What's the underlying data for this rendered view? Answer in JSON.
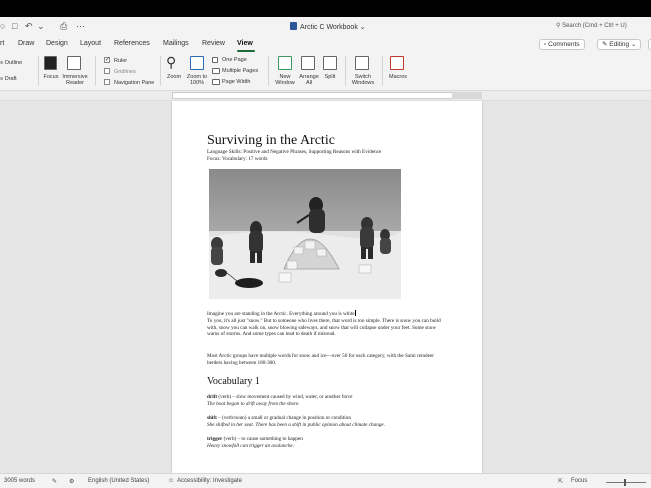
{
  "window": {
    "title": "Arctic C Workbook",
    "search_placeholder": "Search (Cmd + Ctrl + U)"
  },
  "titlebar_icons": [
    "sidebar-icon",
    "save-icon",
    "undo-icon",
    "redo-icon",
    "print-icon",
    "more-icon"
  ],
  "tabs": [
    "rt",
    "Draw",
    "Design",
    "Layout",
    "References",
    "Mailings",
    "Review",
    "View"
  ],
  "active_tab": "View",
  "top_right": {
    "comments": "Comments",
    "editing": "Editing"
  },
  "ribbon": {
    "views": {
      "outline": "Outline",
      "draft": "Draft"
    },
    "focus": "Focus",
    "immersive_reader": "Immersive Reader",
    "ruler": {
      "label": "Ruler",
      "checked": true
    },
    "gridlines": {
      "label": "Gridlines",
      "checked": false
    },
    "navigation_pane": {
      "label": "Navigation Pane",
      "checked": false
    },
    "zoom": "Zoom",
    "zoom_100": "Zoom to 100%",
    "one_page": "One Page",
    "multiple_pages": "Multiple Pages",
    "page_width": "Page Width",
    "new_window": "New Window",
    "arrange_all": "Arrange All",
    "split": "Split",
    "switch_windows": "Switch Windows",
    "macros": "Macros"
  },
  "document": {
    "title": "Surviving in the Arctic",
    "subtitle1": "Language Skills: Positive and Negative Phrases, Supporting Reasons with Evidence",
    "subtitle2": "Focus: Vocabulary: 17 words",
    "para1_before_cursor": "Imagine you are standing in the Arctic. Everything around you is white",
    "para1_rest": "To you, it's all just \"snow.\" But to someone who lives there, that word is too simple. There is snow you can build with, snow you can walk on, snow blowing sideways, and snow that will collapse under your feet. Some snow warns of storms. And some types can lead to death if misread.",
    "para2": "Most Arctic groups have multiple words for snow and ice—over 50 for each category, with the Sami reindeer herders having between 180-300.",
    "vocab_heading": "Vocabulary 1",
    "terms": [
      {
        "word": "drift",
        "def": " (verb) – slow movement caused by wind, water, or another force",
        "example": "The boat began to drift away from the shore."
      },
      {
        "word": "shift",
        "def": " – (verb/noun) a small or gradual change in position or condition",
        "example": "She shifted in her seat. There has been a shift in public opinion about climate change."
      },
      {
        "word": "trigger",
        "def": " (verb) – to cause something to happen",
        "example": "Heavy snowfall can trigger an avalanche."
      }
    ]
  },
  "status": {
    "words": "3005 words",
    "language": "English (United States)",
    "accessibility": "Accessibility: Investigate",
    "focus": "Focus"
  }
}
